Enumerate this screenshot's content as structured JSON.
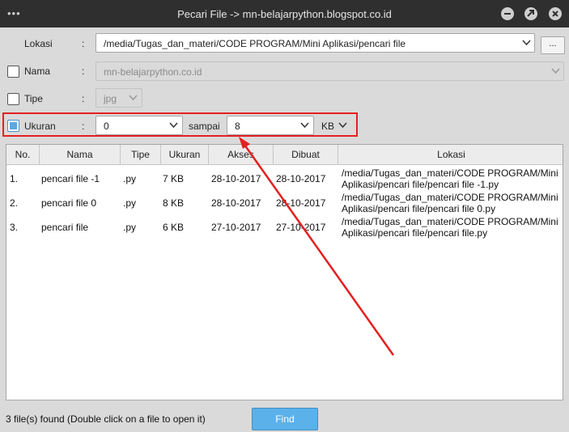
{
  "window": {
    "title": "Pecari File -> mn-belajarpython.blogspot.co.id",
    "menu_dots": "•••"
  },
  "form": {
    "lokasi": {
      "label": "Lokasi",
      "colon": ":",
      "value": "/media/Tugas_dan_materi/CODE PROGRAM/Mini Aplikasi/pencari file",
      "browse_label": "..."
    },
    "nama": {
      "label": "Nama",
      "colon": ":",
      "value": "mn-belajarpython.co.id",
      "checked": false
    },
    "tipe": {
      "label": "Tipe",
      "colon": ":",
      "value": "jpg",
      "checked": false
    },
    "ukuran": {
      "label": "Ukuran",
      "colon": ":",
      "min": "0",
      "between": "sampai",
      "max": "8",
      "unit": "KB",
      "checked": true
    }
  },
  "table": {
    "headers": [
      "No.",
      "Nama",
      "Tipe",
      "Ukuran",
      "Akses",
      "Dibuat",
      "Lokasi"
    ],
    "rows": [
      {
        "no": "1.",
        "nama": "pencari file -1",
        "tipe": ".py",
        "ukuran": "7 KB",
        "akses": "28-10-2017",
        "dibuat": "28-10-2017",
        "lokasi": "/media/Tugas_dan_materi/CODE PROGRAM/Mini Aplikasi/pencari file/pencari file -1.py"
      },
      {
        "no": "2.",
        "nama": "pencari file 0",
        "tipe": ".py",
        "ukuran": "8 KB",
        "akses": "28-10-2017",
        "dibuat": "28-10-2017",
        "lokasi": "/media/Tugas_dan_materi/CODE PROGRAM/Mini Aplikasi/pencari file/pencari file 0.py"
      },
      {
        "no": "3.",
        "nama": "pencari file",
        "tipe": ".py",
        "ukuran": "6 KB",
        "akses": "27-10-2017",
        "dibuat": "27-10-2017",
        "lokasi": "/media/Tugas_dan_materi/CODE PROGRAM/Mini Aplikasi/pencari file/pencari file.py"
      }
    ]
  },
  "footer": {
    "status": "3 file(s) found (Double click on a file to open it)",
    "find_label": "Find"
  },
  "colors": {
    "titlebar": "#2f2f2f",
    "accent": "#5bb1ea",
    "annotation": "#e32020"
  }
}
